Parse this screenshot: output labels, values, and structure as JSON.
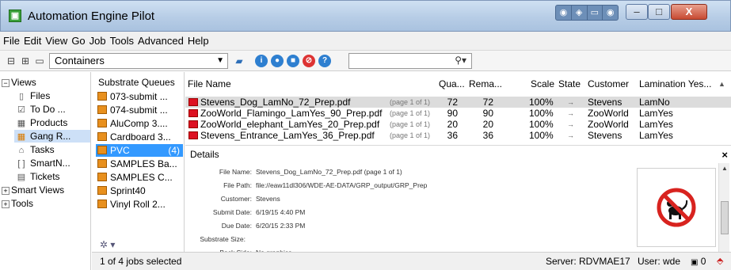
{
  "window": {
    "title": "Automation Engine Pilot",
    "minimize_glyph": "–",
    "maximize_glyph": "□",
    "close_glyph": "X",
    "toolbox_glyphs": [
      "◉",
      "◈",
      "▭",
      "◉"
    ]
  },
  "menu": [
    "File",
    "Edit",
    "View",
    "Go",
    "Job",
    "Tools",
    "Advanced",
    "Help"
  ],
  "toolbar": {
    "view_select_value": "Containers",
    "search_value": "",
    "buttons": [
      "split-panes-icon",
      "grid-view-icon",
      "panel-icon",
      "new-container-icon",
      "info-icon",
      "circle-icon",
      "stop-icon",
      "cancel-icon",
      "help-icon"
    ]
  },
  "nav": {
    "views_label": "Views",
    "items": [
      "Files",
      "To Do ...",
      "Products",
      "Gang R...",
      "Tasks",
      "SmartN...",
      "Tickets"
    ],
    "selected_index": 3,
    "smart_views_label": "Smart Views",
    "tools_label": "Tools"
  },
  "queues": {
    "header": "Substrate Queues",
    "items": [
      {
        "label": "073-submit ..."
      },
      {
        "label": "074-submit ..."
      },
      {
        "label": "AluComp 3...."
      },
      {
        "label": "Cardboard 3..."
      },
      {
        "label": "PVC",
        "count": "(4)"
      },
      {
        "label": "SAMPLES Ba..."
      },
      {
        "label": "SAMPLES C..."
      },
      {
        "label": "Sprint40"
      },
      {
        "label": "Vinyl Roll 2..."
      }
    ],
    "selected_index": 4,
    "footer_glyph": "✲ ▾"
  },
  "jobs": {
    "columns": [
      "File Name",
      "Qua...",
      "Rema...",
      "Scale",
      "State",
      "Customer",
      "Lamination Yes..."
    ],
    "sort_glyph": "▲",
    "rows": [
      {
        "file": "Stevens_Dog_LamNo_72_Prep.pdf",
        "page": "(page 1 of 1)",
        "qty": "72",
        "remaining": "72",
        "scale": "100%",
        "state": "→",
        "customer": "Stevens",
        "lamination": "LamNo"
      },
      {
        "file": "ZooWorld_Flamingo_LamYes_90_Prep.pdf",
        "page": "(page 1 of 1)",
        "qty": "90",
        "remaining": "90",
        "scale": "100%",
        "state": "→",
        "customer": "ZooWorld",
        "lamination": "LamYes"
      },
      {
        "file": "ZooWorld_elephant_LamYes_20_Prep.pdf",
        "page": "(page 1 of 1)",
        "qty": "20",
        "remaining": "20",
        "scale": "100%",
        "state": "→",
        "customer": "ZooWorld",
        "lamination": "LamYes"
      },
      {
        "file": "Stevens_Entrance_LamYes_36_Prep.pdf",
        "page": "(page 1 of 1)",
        "qty": "36",
        "remaining": "36",
        "scale": "100%",
        "state": "→",
        "customer": "Stevens",
        "lamination": "LamYes"
      }
    ],
    "selected_index": 0
  },
  "details": {
    "title": "Details",
    "close_glyph": "×",
    "fields": [
      {
        "label": "File Name:",
        "value": "Stevens_Dog_LamNo_72_Prep.pdf (page 1 of 1)"
      },
      {
        "label": "File Path:",
        "value": "file://eaw11dl306/WDE-AE-DATA/GRP_output/GRP_Prep"
      },
      {
        "label": "Customer:",
        "value": "Stevens"
      },
      {
        "label": "Submit Date:",
        "value": "6/19/15 4:40 PM"
      },
      {
        "label": "Due Date:",
        "value": "6/20/15 2:33 PM"
      },
      {
        "label": "Substrate Size:",
        "value": ""
      },
      {
        "label": "Back Side:",
        "value": "No graphics"
      }
    ],
    "preview_icon": "no-dogs-sign-icon"
  },
  "status": {
    "selection_text": "1 of 4 jobs selected",
    "server_text": "Server: RDVMAE17",
    "user_text": "User: wde",
    "count_text": "0"
  },
  "colors": {
    "selected_queue": "#3399ff",
    "selected_nav": "#cde0f7",
    "selected_row": "#dcdcdc",
    "prohibition_red": "#d8231f"
  }
}
